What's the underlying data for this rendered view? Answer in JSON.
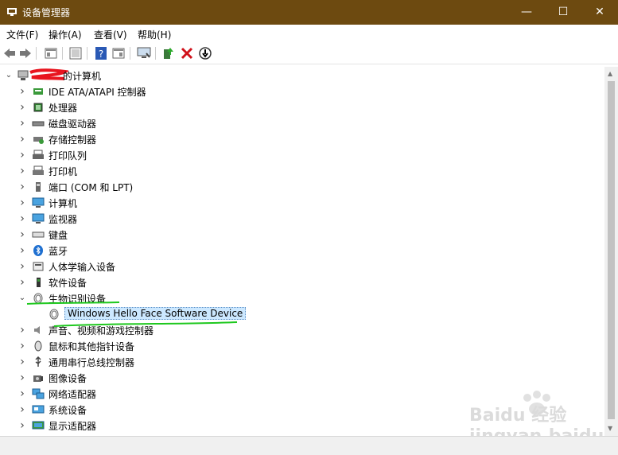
{
  "window": {
    "title": "设备管理器",
    "min": "—",
    "max": "☐",
    "close": "✕"
  },
  "menu": [
    "文件(F)",
    "操作(A)",
    "查看(V)",
    "帮助(H)"
  ],
  "toolbar": {
    "icons": [
      "back-icon",
      "forward-icon",
      "properties-pane-icon",
      "show-hide-icon",
      "help-icon",
      "action-pane-icon",
      "scan-hardware-icon",
      "update-driver-icon",
      "uninstall-icon",
      "disable-icon"
    ]
  },
  "tree": {
    "root": "的计算机",
    "items": [
      {
        "label": "IDE ATA/ATAPI 控制器",
        "icon": "ide-controller-icon"
      },
      {
        "label": "处理器",
        "icon": "processor-icon"
      },
      {
        "label": "磁盘驱动器",
        "icon": "disk-drive-icon"
      },
      {
        "label": "存储控制器",
        "icon": "storage-controller-icon"
      },
      {
        "label": "打印队列",
        "icon": "print-queue-icon"
      },
      {
        "label": "打印机",
        "icon": "printer-icon"
      },
      {
        "label": "端口 (COM 和 LPT)",
        "icon": "port-icon"
      },
      {
        "label": "计算机",
        "icon": "computer-icon"
      },
      {
        "label": "监视器",
        "icon": "monitor-icon"
      },
      {
        "label": "键盘",
        "icon": "keyboard-icon"
      },
      {
        "label": "蓝牙",
        "icon": "bluetooth-icon"
      },
      {
        "label": "人体学输入设备",
        "icon": "hid-icon"
      },
      {
        "label": "软件设备",
        "icon": "software-device-icon"
      },
      {
        "label": "生物识别设备",
        "icon": "biometric-icon",
        "expanded": true
      },
      {
        "label": "Windows Hello Face Software Device",
        "icon": "fingerprint-icon",
        "child": true,
        "selected": true
      },
      {
        "label": "声音、视频和游戏控制器",
        "icon": "sound-icon"
      },
      {
        "label": "鼠标和其他指针设备",
        "icon": "mouse-icon"
      },
      {
        "label": "通用串行总线控制器",
        "icon": "usb-icon"
      },
      {
        "label": "图像设备",
        "icon": "camera-icon"
      },
      {
        "label": "网络适配器",
        "icon": "network-adapter-icon"
      },
      {
        "label": "系统设备",
        "icon": "system-device-icon"
      },
      {
        "label": "显示适配器",
        "icon": "display-adapter-icon"
      }
    ]
  },
  "colors": {
    "titlebar": "#6d4a10",
    "selection": "#cce8ff",
    "annotation_green": "#1ec81e",
    "annotation_red": "#e8141e"
  },
  "watermark": "Baidu 经验 jingyan.baidu.com"
}
